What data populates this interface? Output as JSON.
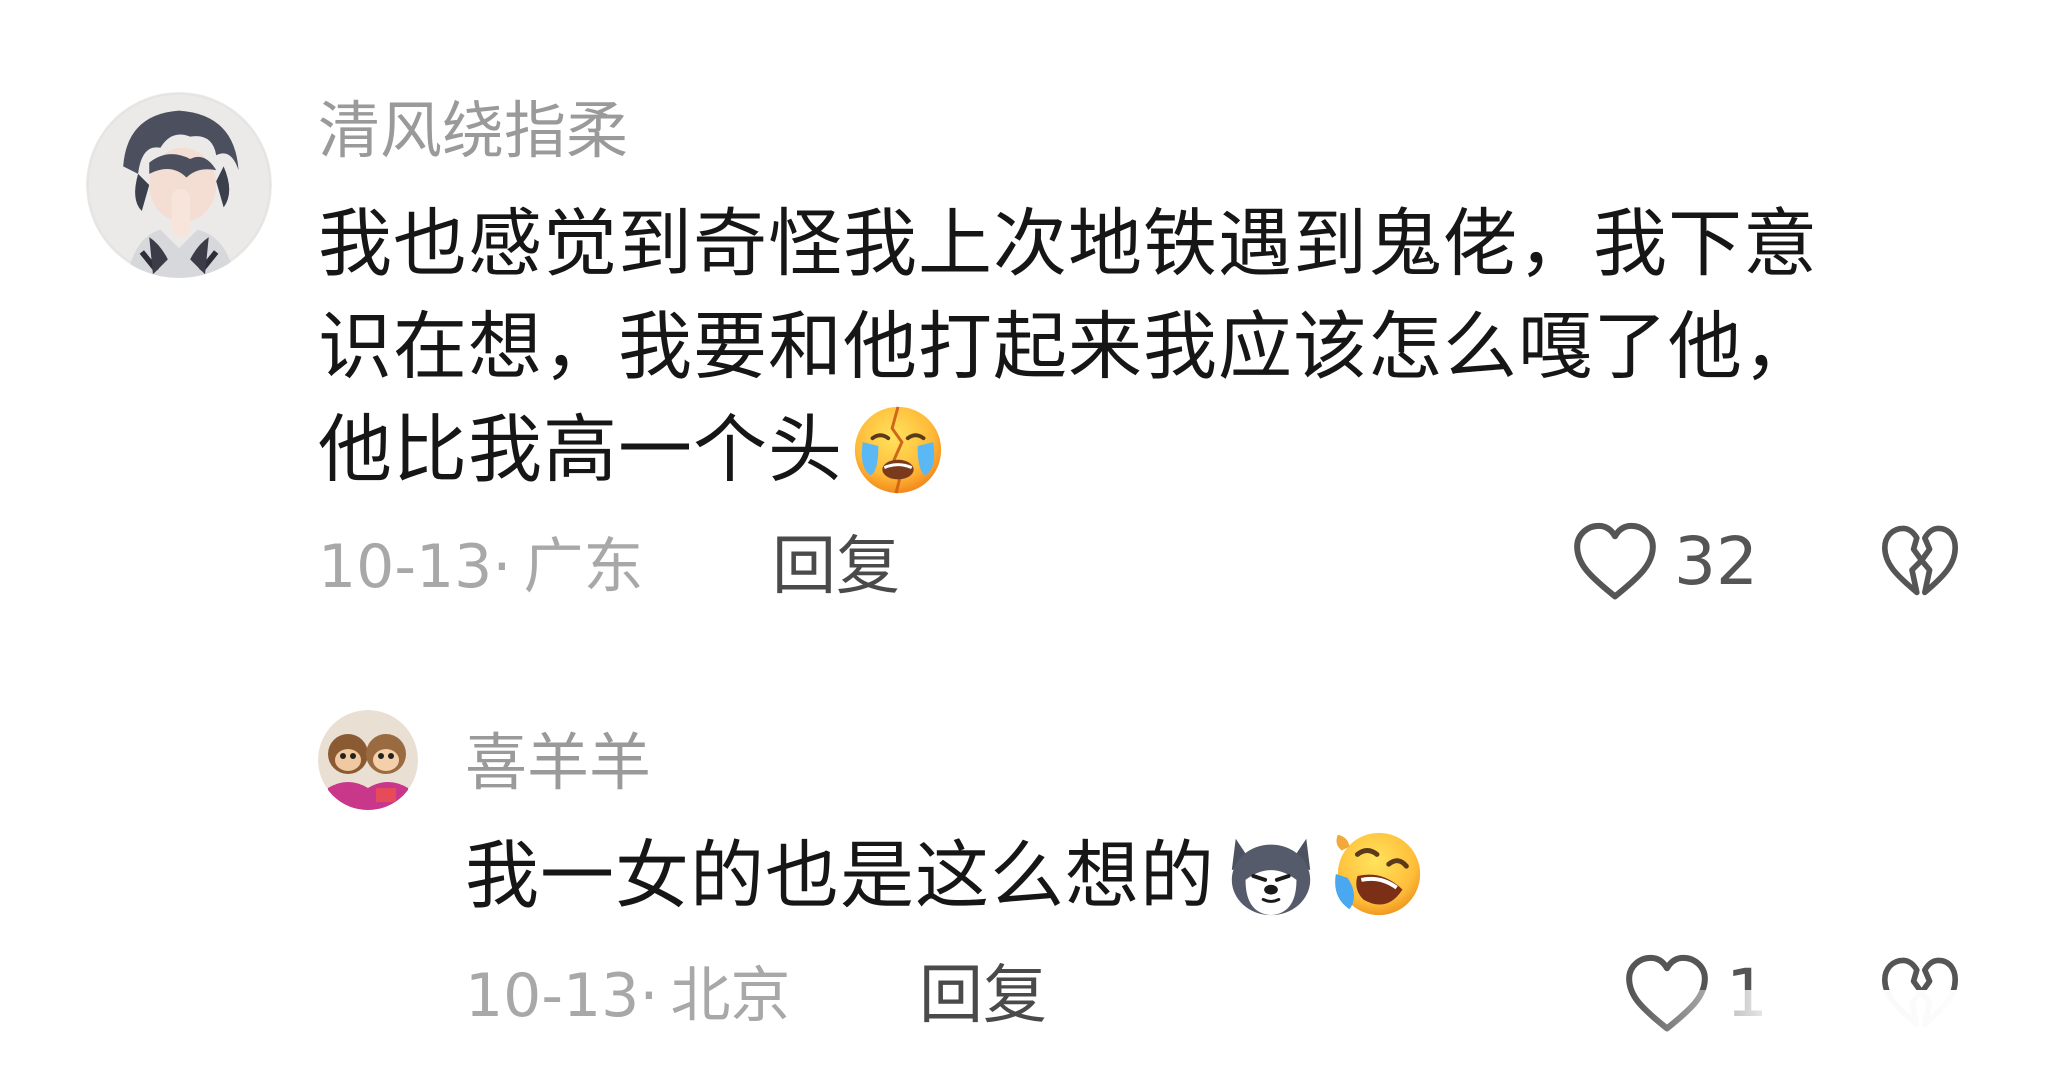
{
  "comments": [
    {
      "username": "清风绕指柔",
      "lines": [
        "我也感觉到奇怪我上次地铁遇到鬼佬，我下意",
        "识在想，我要和他打起来我应该怎么嘎了他，",
        "他比我高一个头"
      ],
      "emojis": [
        "loudly-crying-broken-face"
      ],
      "date": "10-13",
      "separator": "·",
      "location": "广东",
      "reply_label": "回复",
      "likes": "32",
      "avatar": "anime-boy-praying-avatar"
    },
    {
      "username": "喜羊羊",
      "lines": [
        "我一女的也是这么想的"
      ],
      "emojis": [
        "husky-dog-face",
        "rolling-laughing-face"
      ],
      "date": "10-13",
      "separator": "·",
      "location": "北京",
      "reply_label": "回复",
      "likes": "1",
      "avatar": "monkey-dolls-avatar"
    }
  ],
  "colors": {
    "username": "#9a9a9a",
    "text": "#161616",
    "meta": "#a8a8a8",
    "reply": "#4a4a4a",
    "icon": "#555555"
  }
}
